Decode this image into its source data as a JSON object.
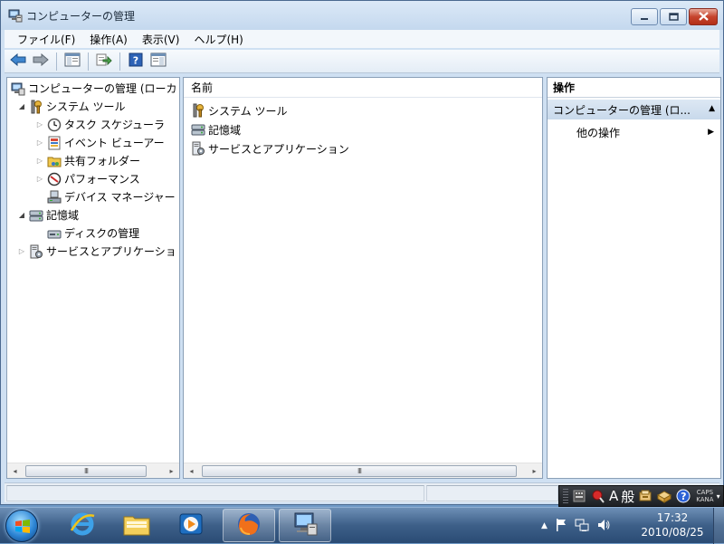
{
  "window": {
    "title": "コンピューターの管理",
    "caption": {
      "minimize_icon": "minimize-icon",
      "maximize_icon": "maximize-icon",
      "close_icon": "close-icon"
    }
  },
  "menubar": {
    "items": [
      {
        "label": "ファイル(F)"
      },
      {
        "label": "操作(A)"
      },
      {
        "label": "表示(V)"
      },
      {
        "label": "ヘルプ(H)"
      }
    ]
  },
  "toolbar": {
    "icons": [
      "back-arrow-icon",
      "forward-arrow-icon",
      "show-hide-tree-icon",
      "export-list-icon",
      "help-icon",
      "show-hide-action-pane-icon"
    ]
  },
  "tree": {
    "items": [
      {
        "label": "コンピューターの管理 (ローカ",
        "icon": "computer-management-icon",
        "expander": ""
      },
      {
        "label": "システム ツール",
        "icon": "system-tools-icon",
        "expander": "◢"
      },
      {
        "label": "タスク スケジューラ",
        "icon": "clock-icon",
        "expander": "▷"
      },
      {
        "label": "イベント ビューアー",
        "icon": "event-viewer-icon",
        "expander": "▷"
      },
      {
        "label": "共有フォルダー",
        "icon": "shared-folder-icon",
        "expander": "▷"
      },
      {
        "label": "パフォーマンス",
        "icon": "performance-icon",
        "expander": "▷"
      },
      {
        "label": "デバイス マネージャー",
        "icon": "device-manager-icon",
        "expander": ""
      },
      {
        "label": "記憶域",
        "icon": "storage-icon",
        "expander": "◢"
      },
      {
        "label": "ディスクの管理",
        "icon": "disk-management-icon",
        "expander": ""
      },
      {
        "label": "サービスとアプリケーショ",
        "icon": "services-icon",
        "expander": "▷"
      }
    ]
  },
  "list": {
    "column_header": "名前",
    "items": [
      {
        "label": "システム ツール",
        "icon": "system-tools-icon"
      },
      {
        "label": "記憶域",
        "icon": "storage-icon"
      },
      {
        "label": "サービスとアプリケーション",
        "icon": "services-icon"
      }
    ]
  },
  "scroll": {
    "left_arrow": "◂",
    "right_arrow": "▸",
    "thumb_grip": "III"
  },
  "actions": {
    "header": "操作",
    "section": "コンピューターの管理 (ロ...",
    "section_caret": "▲",
    "item": "他の操作",
    "item_arrow": "▶"
  },
  "language_bar": {
    "ime_mode": "A",
    "input_mode": "般",
    "caps": "CAPS",
    "kana": "KANA",
    "menu_arrow": "▾",
    "help_glyph": "?",
    "icons": [
      "ime-pad-icon",
      "ime-red-icon",
      "dictionary-icon",
      "toolbox-icon",
      "help-icon"
    ]
  },
  "taskbar": {
    "start_icon": "windows-start-icon",
    "apps": [
      {
        "name": "Internet Explorer",
        "icon": "internet-explorer-icon",
        "active": false
      },
      {
        "name": "Explorer",
        "icon": "folder-icon",
        "active": false
      },
      {
        "name": "Media Player",
        "icon": "media-player-icon",
        "active": false
      },
      {
        "name": "Firefox",
        "icon": "firefox-icon",
        "active": true
      },
      {
        "name": "Computer Management",
        "icon": "computer-management-icon",
        "active": true
      }
    ],
    "tray": {
      "show_hidden_glyph": "▲",
      "icons": [
        "show-hidden-icons-icon",
        "flag-icon",
        "network-icon",
        "volume-icon"
      ]
    },
    "clock": {
      "time": "17:32",
      "date": "2010/08/25"
    }
  },
  "colors": {
    "window_frame": "#cfe0f2",
    "pane_border": "#8a9fb7",
    "action_section": "#c8d9eb",
    "taskbar": "#3d5f88"
  }
}
